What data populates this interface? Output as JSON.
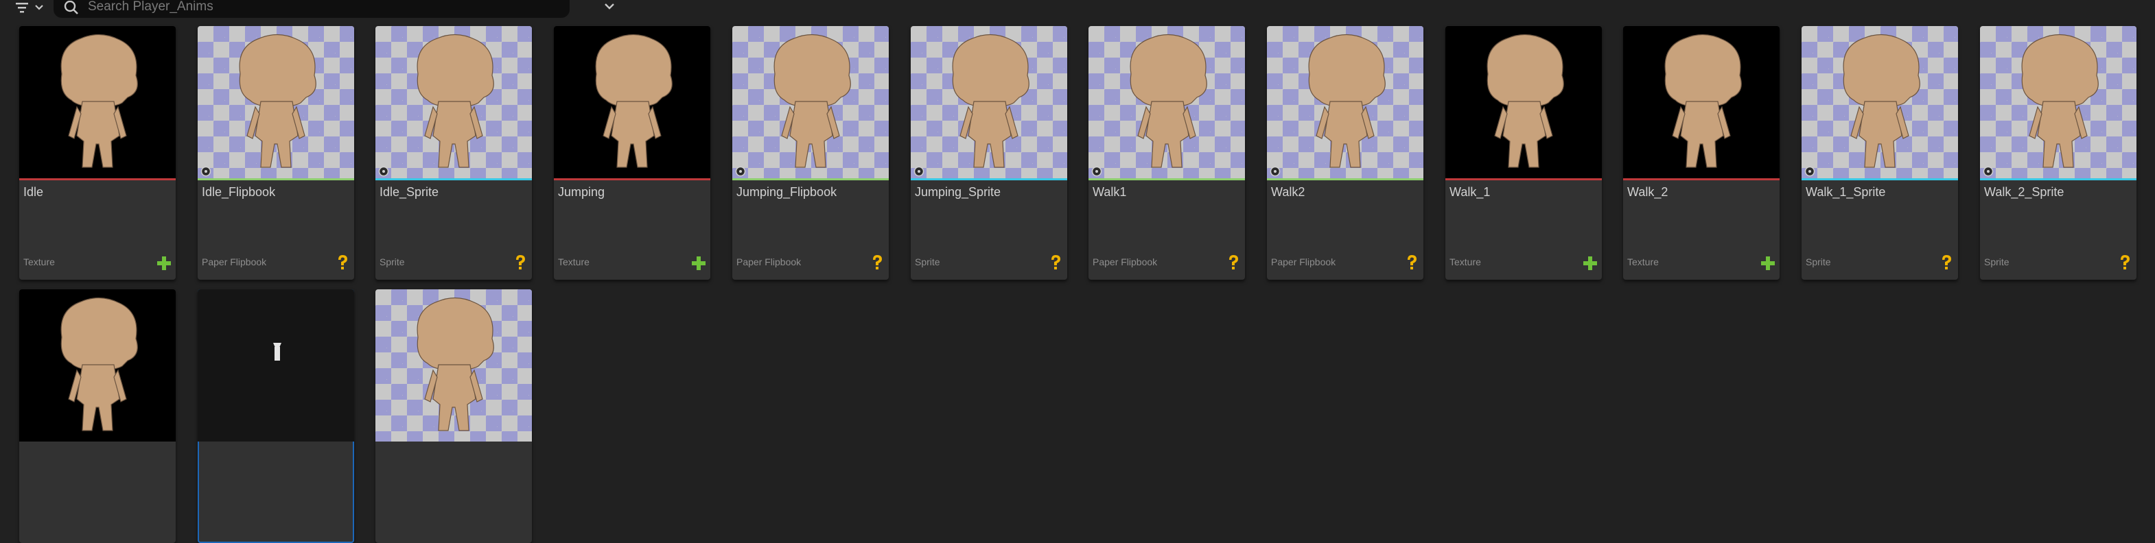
{
  "search": {
    "placeholder": "Search Player_Anims"
  },
  "colors": {
    "texture_underline": "#c0393b",
    "flipbook_underline": "#8fcf6f",
    "sprite_underline": "#3ac9e6",
    "plus_icon": "#6fc23a",
    "question_icon": "#f0b400"
  },
  "assets": [
    {
      "name": "Idle",
      "type": "Texture",
      "bg": "black",
      "status": "plus-icon"
    },
    {
      "name": "Idle_Flipbook",
      "type": "Paper Flipbook",
      "bg": "checker",
      "status": "question-icon"
    },
    {
      "name": "Idle_Sprite",
      "type": "Sprite",
      "bg": "checker",
      "status": "question-icon"
    },
    {
      "name": "Jumping",
      "type": "Texture",
      "bg": "black",
      "status": "plus-icon"
    },
    {
      "name": "Jumping_Flipbook",
      "type": "Paper Flipbook",
      "bg": "checker",
      "status": "question-icon"
    },
    {
      "name": "Jumping_Sprite",
      "type": "Sprite",
      "bg": "checker",
      "status": "question-icon"
    },
    {
      "name": "Walk1",
      "type": "Paper Flipbook",
      "bg": "checker",
      "status": "question-icon"
    },
    {
      "name": "Walk2",
      "type": "Paper Flipbook",
      "bg": "checker",
      "status": "question-icon"
    },
    {
      "name": "Walk_1",
      "type": "Texture",
      "bg": "black",
      "status": "plus-icon"
    },
    {
      "name": "Walk_2",
      "type": "Texture",
      "bg": "black",
      "status": "plus-icon"
    },
    {
      "name": "Walk_1_Sprite",
      "type": "Sprite",
      "bg": "checker",
      "status": "question-icon"
    },
    {
      "name": "Walk_2_Sprite",
      "type": "Sprite",
      "bg": "checker",
      "status": "question-icon"
    }
  ],
  "row2": [
    {
      "bg": "black"
    },
    {
      "bg": "dark",
      "selected": true
    },
    {
      "bg": "checker"
    }
  ]
}
